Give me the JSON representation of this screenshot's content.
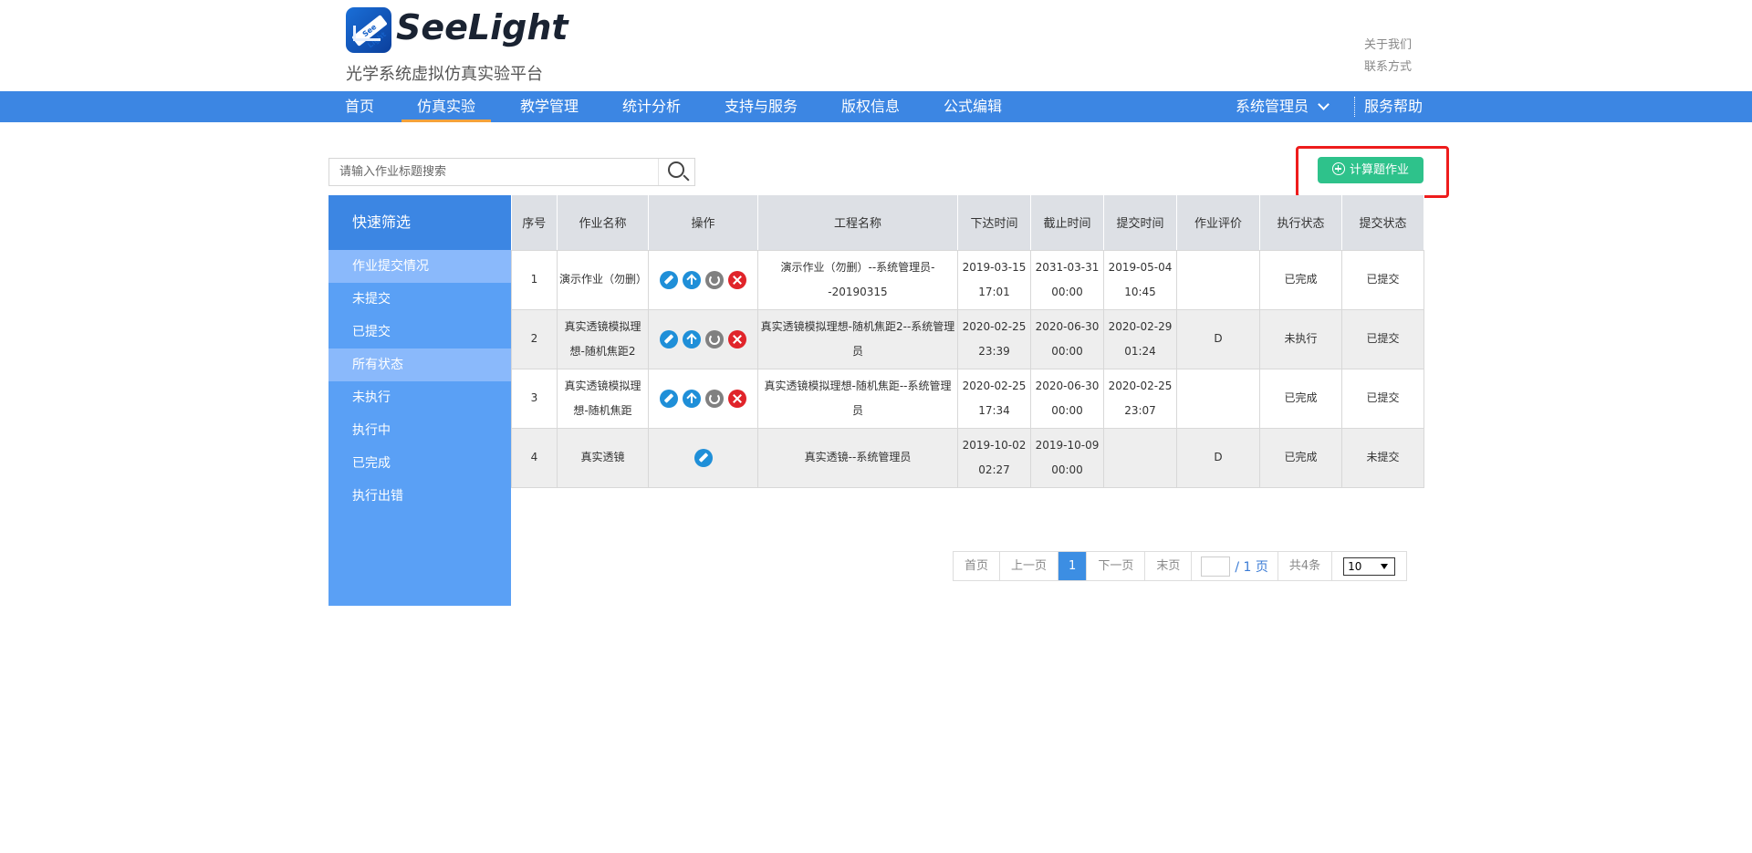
{
  "brand": {
    "name": "SeeLight",
    "subtitle": "光学系统虚拟仿真实验平台",
    "icon_text": "See Light"
  },
  "top_links": [
    "关于我们",
    "联系方式"
  ],
  "nav": {
    "items": [
      "首页",
      "仿真实验",
      "教学管理",
      "统计分析",
      "支持与服务",
      "版权信息",
      "公式编辑"
    ],
    "active": "仿真实验",
    "user": "系统管理员",
    "help": "服务帮助"
  },
  "search": {
    "placeholder": "请输入作业标题搜索",
    "value": ""
  },
  "add_button": "计算题作业",
  "sidebar": {
    "title": "快速筛选",
    "group1": "作业提交情况",
    "group1_items": [
      "未提交",
      "已提交"
    ],
    "group2": "所有状态",
    "group2_items": [
      "未执行",
      "执行中",
      "已完成",
      "执行出错"
    ]
  },
  "table": {
    "headers": [
      "序号",
      "作业名称",
      "操作",
      "工程名称",
      "下达时间",
      "截止时间",
      "提交时间",
      "作业评价",
      "执行状态",
      "提交状态"
    ],
    "rows": [
      {
        "no": "1",
        "name": "演示作业（勿删）",
        "project": "演示作业（勿删）--系统管理员--20190315",
        "issued": "2019-03-15 17:01",
        "deadline": "2031-03-31 00:00",
        "submitted": "2019-05-04 10:45",
        "evaluation": "",
        "exec_status": "已完成",
        "submit_status": "已提交"
      },
      {
        "no": "2",
        "name": "真实透镜模拟理想-随机焦距2",
        "project": "真实透镜模拟理想-随机焦距2--系统管理员",
        "issued": "2020-02-25 23:39",
        "deadline": "2020-06-30 00:00",
        "submitted": "2020-02-29 01:24",
        "evaluation": "D",
        "exec_status": "未执行",
        "submit_status": "已提交"
      },
      {
        "no": "3",
        "name": "真实透镜模拟理想-随机焦距",
        "project": "真实透镜模拟理想-随机焦距--系统管理员",
        "issued": "2020-02-25 17:34",
        "deadline": "2020-06-30 00:00",
        "submitted": "2020-02-25 23:07",
        "evaluation": "",
        "exec_status": "已完成",
        "submit_status": "已提交"
      },
      {
        "no": "4",
        "name": "真实透镜",
        "project": "真实透镜--系统管理员",
        "issued": "2019-10-02 02:27",
        "deadline": "2019-10-09 00:00",
        "submitted": "",
        "evaluation": "D",
        "exec_status": "已完成",
        "submit_status": "未提交"
      }
    ]
  },
  "pagination": {
    "first": "首页",
    "prev": "上一页",
    "current": "1",
    "next": "下一页",
    "last": "末页",
    "page_input": "",
    "total_pages": "/ 1 页",
    "total_count": "共4条",
    "page_size": "10"
  }
}
